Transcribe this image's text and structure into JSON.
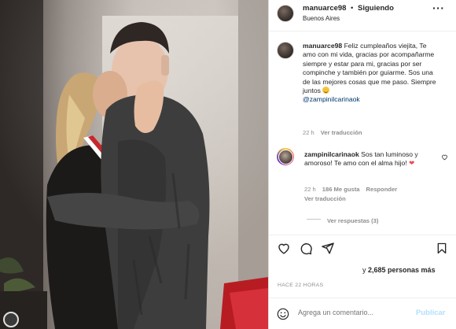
{
  "post": {
    "username": "manuarce98",
    "separator": "•",
    "follow_status": "Siguiendo",
    "location": "Buenos Aires",
    "more_icon": "more-horizontal-icon"
  },
  "caption": {
    "username": "manuarce98",
    "text": "Feliz cumpleaños viejita, Te amo con mi vida, gracias por acompañarme siempre y estar para mi, gracias por ser compinche y también por guiarme. Sos una de las mejores cosas que me paso. Siempre juntos",
    "emoji": "smiling-face-with-hearts",
    "mention": "@zampinilcarinaok",
    "time": "22 h",
    "translate": "Ver traducción"
  },
  "reply": {
    "username": "zampinilcarinaok",
    "text": "Sos tan luminoso y amoroso! Te amo con el alma hijo!",
    "emoji": "red-heart",
    "time": "22 h",
    "likes": "186 Me gusta",
    "reply_label": "Responder",
    "translate": "Ver traducción",
    "view_replies": "Ver respuestas (3)"
  },
  "actions": {
    "icons": [
      "heart-icon",
      "comment-icon",
      "share-icon",
      "bookmark-icon"
    ]
  },
  "likes": {
    "prefix": "y",
    "count": "2,685 personas más"
  },
  "timestamp": "HACE 22 HORAS",
  "comment_box": {
    "placeholder": "Agrega un comentario...",
    "publish_label": "Publicar"
  },
  "colors": {
    "accent_link": "#00376b",
    "publish_disabled": "#b2dffc",
    "heart": "#ed4956",
    "muted": "#8e8e8e"
  }
}
